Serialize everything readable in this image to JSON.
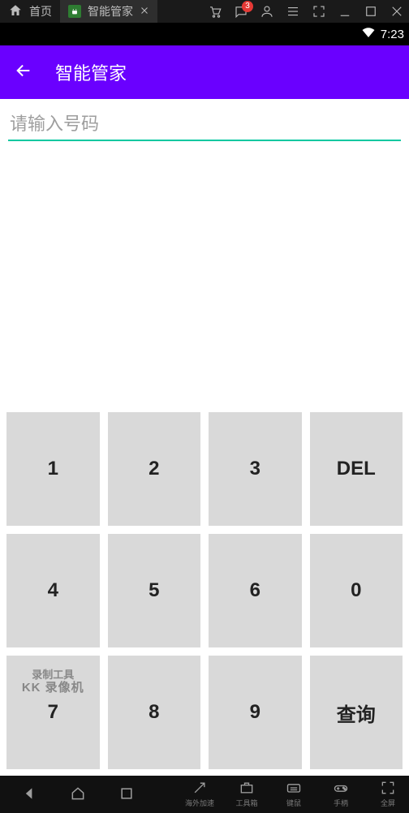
{
  "emulator": {
    "tabs": [
      {
        "label": "首页"
      },
      {
        "label": "智能管家",
        "active": true
      }
    ],
    "badge_count": "3",
    "bottom_tools": [
      "海外加速",
      "工具箱",
      "键鼠",
      "手柄",
      "全屏"
    ]
  },
  "status_bar": {
    "time": "7:23"
  },
  "app": {
    "title": "智能管家",
    "input_placeholder": "请输入号码"
  },
  "keypad": {
    "rows": [
      [
        "1",
        "2",
        "3",
        "DEL"
      ],
      [
        "4",
        "5",
        "6",
        "0"
      ],
      [
        "7",
        "8",
        "9",
        "查询"
      ]
    ]
  },
  "watermark": {
    "line1": "录制工具",
    "line2": "KK 录像机"
  }
}
